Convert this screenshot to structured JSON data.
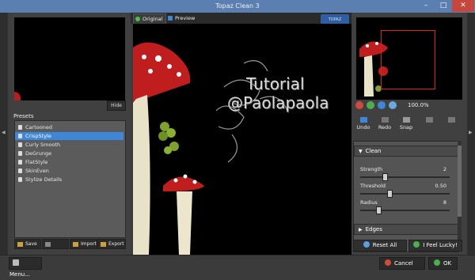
{
  "window": {
    "title": "Topaz Clean 3",
    "min_glyph": "–",
    "max_glyph": "□",
    "close_glyph": "✕"
  },
  "left": {
    "hide_label": "Hide",
    "presets_label": "Presets",
    "presets": [
      "Cartooned",
      "CrispStyle",
      "Curly Smooth",
      "DeGrunge",
      "FlatStyle",
      "SkinEven",
      "Stylize Details"
    ],
    "selected_preset": "CrispStyle",
    "buttons": {
      "save": "Save",
      "delete": "",
      "import": "Import",
      "export": "Export"
    }
  },
  "canvas": {
    "tabs": {
      "original": "Original",
      "preview": "Preview"
    },
    "watermark_line1": "Tutorial",
    "watermark_line2": "@Paolapaola",
    "logo_text": "TOPAZ"
  },
  "right": {
    "zoom": "100.0%",
    "tools": {
      "undo": "Undo",
      "redo": "Redo",
      "snap": "Snap",
      "compare": "",
      "settings": ""
    },
    "sections": {
      "clean": {
        "title": "Clean",
        "params": [
          {
            "label": "Strength",
            "value": "2",
            "fraction": 0.27
          },
          {
            "label": "Threshold",
            "value": "0.50",
            "fraction": 0.33
          },
          {
            "label": "Radius",
            "value": "8",
            "fraction": 0.2
          }
        ]
      },
      "edges": {
        "title": "Edges"
      }
    },
    "reset_label": "Reset All",
    "lucky_label": "I Feel Lucky!"
  },
  "bottom": {
    "menu_label": "Menu...",
    "cancel_label": "Cancel",
    "ok_label": "OK"
  },
  "colors": {
    "accent": "#3d86d8",
    "titlebar": "#5a7fb0",
    "close": "#c7473c",
    "mushroom_red": "#b81c1c",
    "nav_rect": "#e02020"
  }
}
